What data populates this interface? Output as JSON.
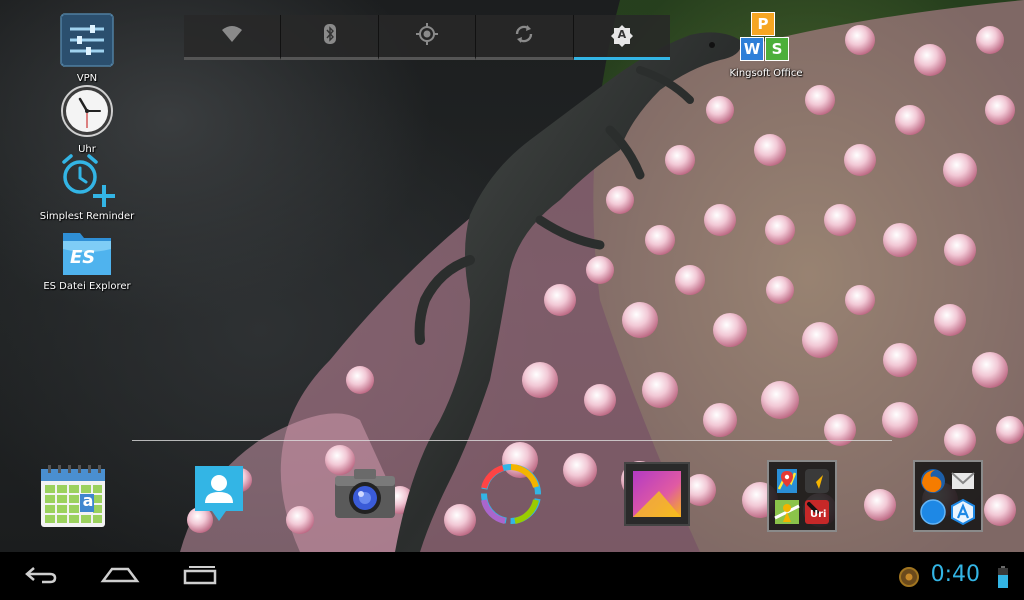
{
  "quick_settings": {
    "items": [
      {
        "name": "wifi-icon",
        "active": false
      },
      {
        "name": "bluetooth-icon",
        "active": false
      },
      {
        "name": "location-icon",
        "active": false
      },
      {
        "name": "sync-icon",
        "active": false
      },
      {
        "name": "auto-brightness-icon",
        "active": true
      }
    ],
    "auto_brightness_glyph": "A"
  },
  "desktop": {
    "vpn_label": "VPN",
    "clock_label": "Uhr",
    "reminder_label": "Simplest Reminder",
    "es_label": "ES Datei Explorer",
    "es_glyph": "ES",
    "kingsoft_label": "Kingsoft Office",
    "kingsoft_letters": [
      "P",
      "W",
      "S"
    ]
  },
  "dock": {
    "calendar_glyph": "a",
    "folder1_apps": [
      "maps-icon",
      "navigation-icon",
      "street-view-icon",
      "uri-icon"
    ],
    "folder1_uri_text": "Uri",
    "folder2_apps": [
      "firefox-icon",
      "email-icon",
      "globe-icon",
      "app-store-icon"
    ]
  },
  "status": {
    "time": "0:40"
  },
  "colors": {
    "accent": "#33b5e5"
  }
}
